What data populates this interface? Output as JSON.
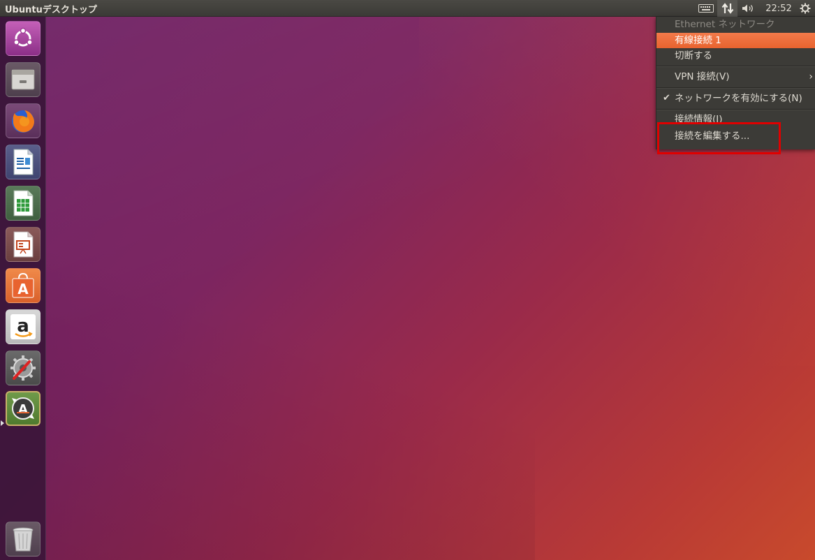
{
  "top_panel": {
    "window_title": "Ubuntuデスクトップ",
    "clock": "22:52"
  },
  "launcher": {
    "items": [
      {
        "icon": "ubuntu-dash-icon"
      },
      {
        "icon": "files-icon"
      },
      {
        "icon": "firefox-icon"
      },
      {
        "icon": "libreoffice-writer-icon"
      },
      {
        "icon": "libreoffice-calc-icon"
      },
      {
        "icon": "libreoffice-impress-icon"
      },
      {
        "icon": "ubuntu-software-icon"
      },
      {
        "icon": "amazon-icon"
      },
      {
        "icon": "system-settings-icon"
      },
      {
        "icon": "software-updater-icon"
      },
      {
        "icon": "trash-icon"
      }
    ]
  },
  "network_menu": {
    "header": "Ethernet ネットワーク",
    "wired_connection": "有線接続 1",
    "disconnect": "切断する",
    "vpn": "VPN 接続(V)",
    "enable_networking": "ネットワークを有効にする(N)",
    "connection_info": "接続情報(I)",
    "edit_connections": "接続を編集する..."
  },
  "colors": {
    "accent": "#e8632f",
    "highlight_box": "#e00000",
    "menu_bg": "#3c3b37"
  }
}
